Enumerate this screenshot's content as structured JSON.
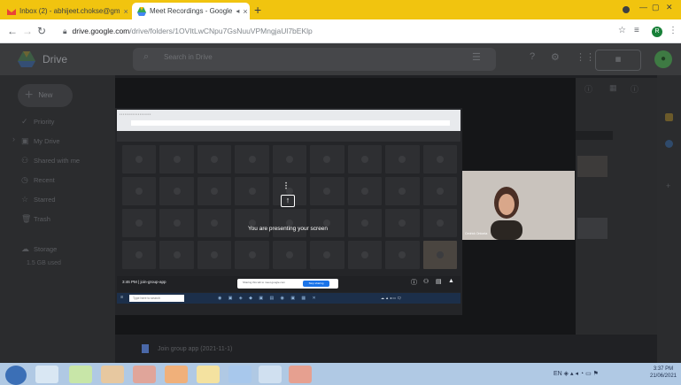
{
  "browser": {
    "tabs": [
      {
        "label": "Inbox (2) - abhijeet.chokse@gm",
        "close": "×",
        "icon": "gmail-icon"
      },
      {
        "label": "Meet Recordings - Google",
        "close": "×",
        "icon": "drive-icon"
      }
    ],
    "new_tab": "+",
    "url_domain": "drive.google.com",
    "url_path": "/drive/folders/1OVItLwCNpu7GsNuuVPMngjaUl7bEKlp",
    "profile_initial": "R"
  },
  "drive": {
    "name": "Drive",
    "search_placeholder": "Search in Drive",
    "new_label": "New",
    "sidebar": [
      {
        "label": "Priority",
        "icon": "check-icon"
      },
      {
        "label": "My Drive",
        "icon": "drive-folder-icon"
      },
      {
        "label": "Shared with me",
        "icon": "people-icon"
      },
      {
        "label": "Recent",
        "icon": "clock-icon"
      },
      {
        "label": "Starred",
        "icon": "star-icon"
      },
      {
        "label": "Trash",
        "icon": "trash-icon"
      },
      {
        "label": "Storage",
        "icon": "cloud-icon"
      }
    ],
    "storage_text": "1.5 GB used",
    "file_row": "Join group app (2021-11-1)"
  },
  "meet": {
    "present_message": "You are presenting your screen",
    "time": "3:46 PM",
    "meeting_code": "join-group-app",
    "popup_text": "Sharing this tab to meet.google.com",
    "popup_button": "Stop sharing",
    "participant_name": "Cedrick Ontonta",
    "inner_search": "Type here to search"
  },
  "taskbar": {
    "time": "3:37 PM",
    "date": "21/06/2021",
    "lang": "EN"
  }
}
